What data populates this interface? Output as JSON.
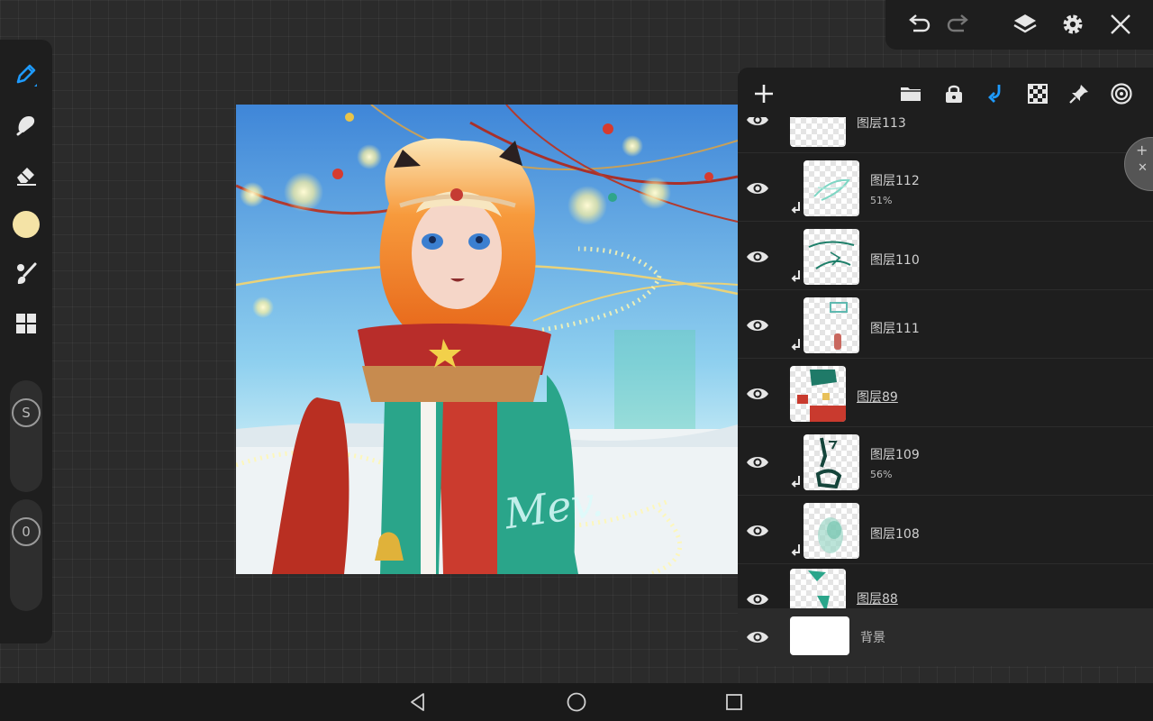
{
  "toolbar": {
    "tools": [
      {
        "icon": "brush-pen-icon",
        "active": true
      },
      {
        "icon": "smudge-icon"
      },
      {
        "icon": "eraser-icon"
      },
      {
        "icon": "color-swatch",
        "color": "#f4e3a6"
      },
      {
        "icon": "brush-palette-icon"
      },
      {
        "icon": "gallery-grid-icon"
      }
    ],
    "size_slider_label": "S",
    "opacity_slider_label": "0"
  },
  "topbar": {
    "icons": [
      "undo-icon",
      "redo-icon",
      "layers-icon",
      "settings-icon",
      "close-icon"
    ]
  },
  "layers_header": {
    "icons": [
      "add-layer-icon",
      "folder-icon",
      "lock-icon",
      "clip-arrow-icon",
      "transparency-icon",
      "pin-icon",
      "blend-target-icon"
    ]
  },
  "layers": [
    {
      "name": "图层113",
      "opacity": "",
      "clipped": false,
      "underline": false
    },
    {
      "name": "图层112",
      "opacity": "51%",
      "clipped": true,
      "underline": false
    },
    {
      "name": "图层110",
      "opacity": "",
      "clipped": true,
      "underline": false
    },
    {
      "name": "图层111",
      "opacity": "",
      "clipped": true,
      "underline": false
    },
    {
      "name": "图层89",
      "opacity": "",
      "clipped": false,
      "underline": true
    },
    {
      "name": "图层109",
      "opacity": "56%",
      "clipped": true,
      "underline": false
    },
    {
      "name": "图层108",
      "opacity": "",
      "clipped": true,
      "underline": false
    },
    {
      "name": "图层88",
      "opacity": "",
      "clipped": false,
      "underline": true
    }
  ],
  "background_layer": {
    "name": "背景"
  },
  "canvas": {
    "signature": "Mev."
  },
  "colors": {
    "accent": "#1e9bff",
    "panel": "#1e1e1e",
    "workspace": "#2b2b2b",
    "primary_color": "#f4e3a6"
  },
  "nav": {
    "icons": [
      "back-triangle-icon",
      "home-circle-icon",
      "recents-square-icon"
    ]
  }
}
